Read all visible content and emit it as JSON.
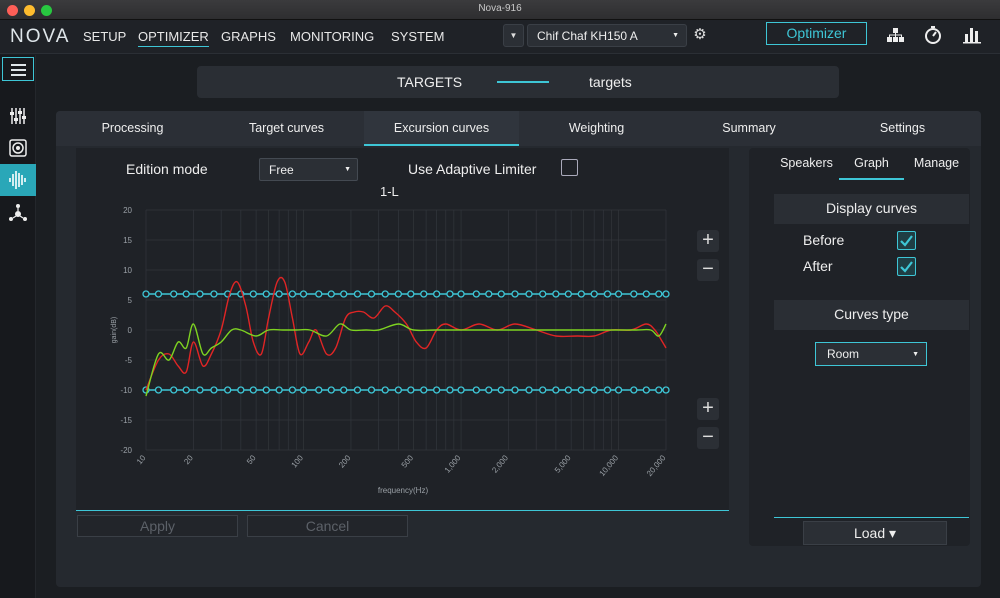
{
  "window": {
    "title": "Nova-916"
  },
  "nav": {
    "logo": "NOVA",
    "items": [
      "SETUP",
      "OPTIMIZER",
      "GRAPHS",
      "MONITORING",
      "SYSTEM"
    ],
    "active": "OPTIMIZER",
    "speaker": "Chif Chaf KH150 A",
    "optimizer_button": "Optimizer",
    "icons": [
      "hierarchy-icon",
      "stopwatch-icon",
      "bar-chart-icon"
    ]
  },
  "sidebar": {
    "icons": [
      "menu-icon",
      "mixer-icon",
      "speaker-icon",
      "waveform-icon",
      "network-icon"
    ]
  },
  "targets": {
    "left": "TARGETS",
    "right": "targets"
  },
  "tabs": [
    "Processing",
    "Target curves",
    "Excursion curves",
    "Weighting",
    "Summary",
    "Settings"
  ],
  "active_tab": "Excursion curves",
  "graph": {
    "edition_mode_label": "Edition mode",
    "edition_mode_value": "Free",
    "limiter_label": "Use Adaptive Limiter",
    "limiter_checked": false,
    "channel": "1-L",
    "apply": "Apply",
    "cancel": "Cancel"
  },
  "right": {
    "tabs": [
      "Speakers",
      "Graph",
      "Manage"
    ],
    "active_tab": "Graph",
    "display_curves": "Display curves",
    "before_label": "Before",
    "after_label": "After",
    "before_checked": true,
    "after_checked": true,
    "curves_type_label": "Curves type",
    "curves_type_value": "Room",
    "load": "Load ▾"
  },
  "colors": {
    "accent": "#3ec6d6",
    "red_curve": "#e02525",
    "green_curve": "#7ed321",
    "yellow_curve": "#e8d020"
  },
  "chart_data": {
    "type": "line",
    "xlabel": "frequency(Hz)",
    "ylabel": "gain(dB)",
    "xscale": "log",
    "xlim": [
      10,
      20000
    ],
    "ylim": [
      -20,
      20
    ],
    "yticks": [
      20,
      15,
      10,
      5,
      0,
      -5,
      -10,
      -15,
      -20
    ],
    "xticks": [
      10,
      20,
      50,
      100,
      200,
      500,
      1000,
      2000,
      5000,
      10000,
      20000
    ],
    "xtick_labels": [
      "10",
      "20",
      "50",
      "100",
      "200",
      "500",
      "1,000",
      "2,000",
      "5,000",
      "10,000",
      "20,000"
    ],
    "series": [
      {
        "color": "#3ec6d6",
        "x": [
          10,
          12,
          15,
          18,
          22,
          27,
          33,
          40,
          48,
          58,
          70,
          85,
          100,
          125,
          150,
          180,
          220,
          270,
          330,
          400,
          480,
          580,
          700,
          850,
          1000,
          1250,
          1500,
          1800,
          2200,
          2700,
          3300,
          4000,
          4800,
          5800,
          7000,
          8500,
          10000,
          12500,
          15000,
          18000,
          20000
        ],
        "values": [
          6,
          6,
          6,
          6,
          6,
          6,
          6,
          6,
          6,
          6,
          6,
          6,
          6,
          6,
          6,
          6,
          6,
          6,
          6,
          6,
          6,
          6,
          6,
          6,
          6,
          6,
          6,
          6,
          6,
          6,
          6,
          6,
          6,
          6,
          6,
          6,
          6,
          6,
          6,
          6,
          6
        ]
      },
      {
        "color": "#3ec6d6",
        "x": [
          10,
          12,
          15,
          18,
          22,
          27,
          33,
          40,
          48,
          58,
          70,
          85,
          100,
          125,
          150,
          180,
          220,
          270,
          330,
          400,
          480,
          580,
          700,
          850,
          1000,
          1250,
          1500,
          1800,
          2200,
          2700,
          3300,
          4000,
          4800,
          5800,
          7000,
          8500,
          10000,
          12500,
          15000,
          18000,
          20000
        ],
        "values": [
          -10,
          -10,
          -10,
          -10,
          -10,
          -10,
          -10,
          -10,
          -10,
          -10,
          -10,
          -10,
          -10,
          -10,
          -10,
          -10,
          -10,
          -10,
          -10,
          -10,
          -10,
          -10,
          -10,
          -10,
          -10,
          -10,
          -10,
          -10,
          -10,
          -10,
          -10,
          -10,
          -10,
          -10,
          -10,
          -10,
          -10,
          -10,
          -10,
          -10,
          -10
        ]
      },
      {
        "color": "#e02525",
        "x": [
          10,
          12,
          14,
          16,
          18,
          20,
          23,
          26,
          30,
          34,
          38,
          43,
          48,
          54,
          60,
          68,
          76,
          85,
          95,
          108,
          120,
          140,
          160,
          185,
          210,
          240,
          280,
          330,
          380,
          450,
          520,
          600,
          700,
          800,
          1000,
          1300,
          1700,
          2200,
          3000,
          4000,
          5500,
          7000,
          9000,
          12000,
          15000,
          17000,
          19000,
          20000
        ],
        "values": [
          -10,
          -5,
          -4,
          -6,
          -7,
          -2,
          -6,
          -4,
          0,
          6,
          8,
          4,
          -2,
          -4,
          2,
          8,
          8,
          2,
          -4,
          -2,
          0,
          -4,
          -3,
          2,
          3,
          3,
          2,
          4,
          3,
          1,
          -2,
          -3,
          0,
          1,
          0,
          1,
          0,
          1,
          0,
          -1,
          -1,
          -1,
          0,
          0,
          1,
          0,
          -2,
          -3
        ]
      },
      {
        "color": "#7ed321",
        "x": [
          10,
          12,
          14,
          16,
          18,
          20,
          23,
          26,
          30,
          35,
          40,
          50,
          60,
          75,
          90,
          110,
          140,
          170,
          200,
          250,
          300,
          400,
          500,
          700,
          1000,
          1500,
          2000,
          3000,
          4000,
          6000,
          8000,
          10000,
          13000,
          16000,
          18000,
          20000
        ],
        "values": [
          -11,
          -4,
          -5,
          -2,
          -3,
          1,
          -4,
          -3,
          -2,
          0,
          0,
          -1,
          0,
          0,
          0,
          0,
          -1,
          1,
          0,
          0,
          0,
          1,
          0,
          0,
          0,
          0,
          0,
          0,
          0,
          0,
          0,
          0,
          0,
          0,
          -1,
          1
        ]
      }
    ]
  }
}
